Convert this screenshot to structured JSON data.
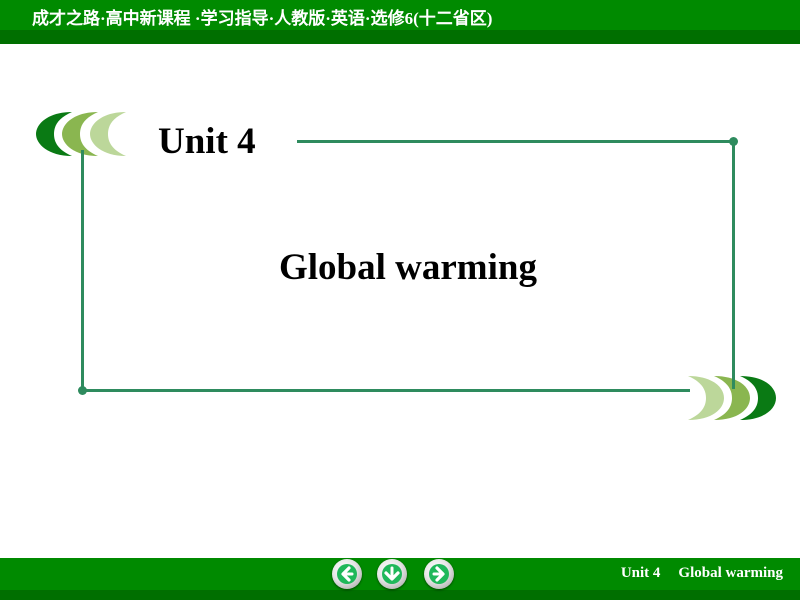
{
  "header": {
    "title": "成才之路·高中新课程 ·学习指导·人教版·英语·选修6(十二省区)"
  },
  "slide": {
    "unit_label": "Unit 4",
    "title": "Global warming"
  },
  "footer": {
    "unit": "Unit 4",
    "topic": "Global warming",
    "nav": {
      "prev_icon": "arrow-left-icon",
      "home_icon": "arrow-down-icon",
      "next_icon": "arrow-right-icon"
    }
  },
  "colors": {
    "bar_green": "#008a00",
    "bar_dark_green": "#006f00",
    "frame_green": "#2e8b5e",
    "leaf_dark": "#0a7a14",
    "leaf_mid": "#8ab650",
    "leaf_light": "#bcd79a",
    "arrow_green": "#1fb85a"
  }
}
